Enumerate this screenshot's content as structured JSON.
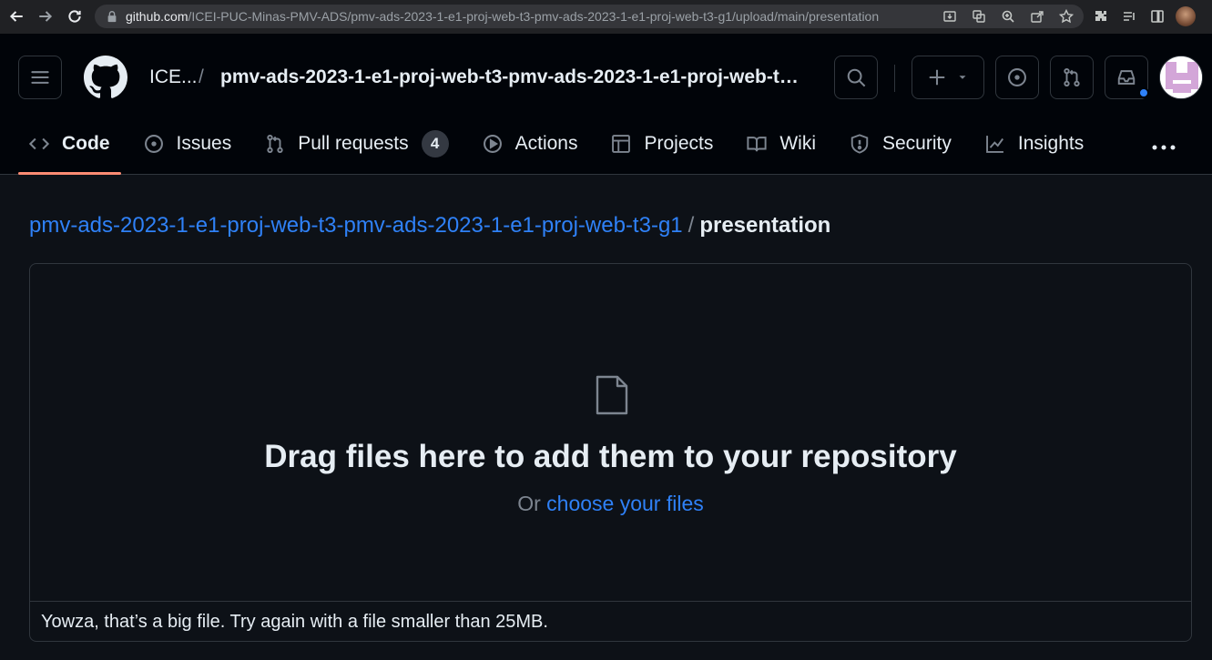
{
  "browser": {
    "url_host": "github.com",
    "url_path": "/ICEI-PUC-Minas-PMV-ADS/pmv-ads-2023-1-e1-proj-web-t3-pmv-ads-2023-1-e1-proj-web-t3-g1/upload/main/presentation"
  },
  "header": {
    "owner": "ICE...",
    "separator": "/",
    "repo": "pmv-ads-2023-1-e1-proj-web-t3-pmv-ads-2023-1-e1-proj-web-t3..."
  },
  "tabs": [
    {
      "label": "Code",
      "icon": "code-icon"
    },
    {
      "label": "Issues",
      "icon": "issue-icon"
    },
    {
      "label": "Pull requests",
      "icon": "pull-request-icon",
      "count": "4"
    },
    {
      "label": "Actions",
      "icon": "play-icon"
    },
    {
      "label": "Projects",
      "icon": "table-icon"
    },
    {
      "label": "Wiki",
      "icon": "book-icon"
    },
    {
      "label": "Security",
      "icon": "shield-icon"
    },
    {
      "label": "Insights",
      "icon": "graph-icon"
    }
  ],
  "breadcrumb": {
    "repo_link": "pmv-ads-2023-1-e1-proj-web-t3-pmv-ads-2023-1-e1-proj-web-t3-g1",
    "separator": "/",
    "current": "presentation"
  },
  "upload": {
    "title": "Drag files here to add them to your repository",
    "or_text": "Or",
    "choose_link": "choose your files",
    "error": "Yowza, that’s a big file. Try again with a file smaller than 25MB."
  },
  "colors": {
    "accent": "#2f81f7",
    "active_tab_underline": "#fd8c73",
    "background": "#0d1117"
  }
}
